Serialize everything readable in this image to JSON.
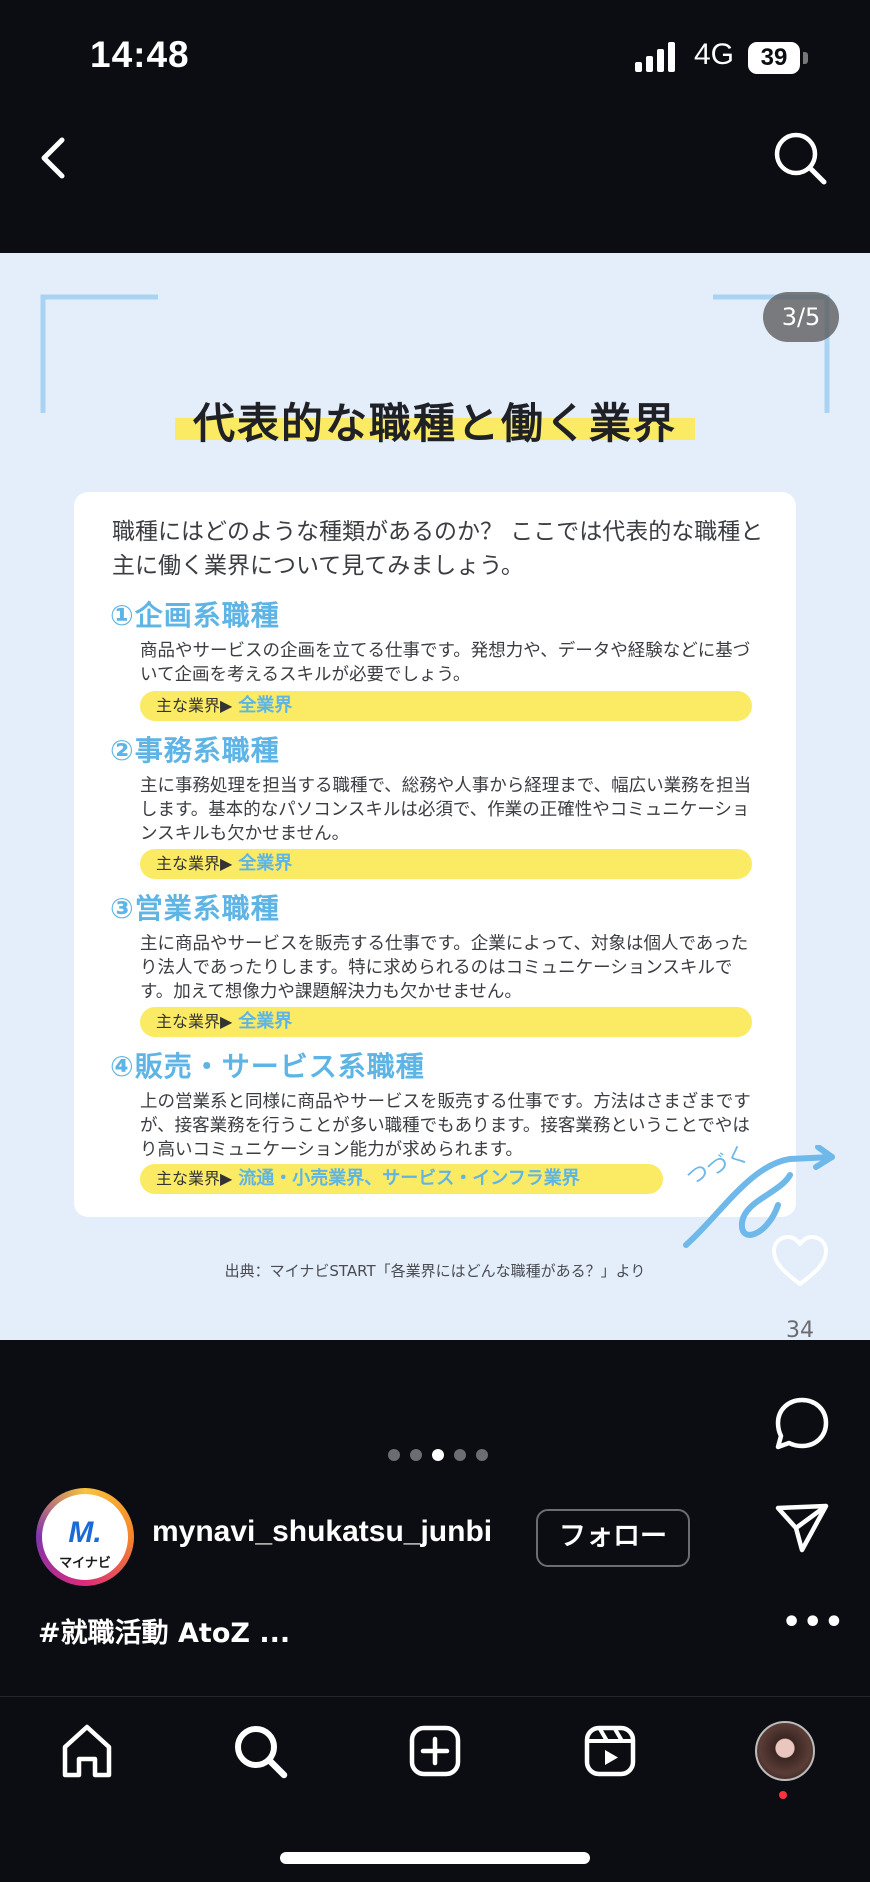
{
  "status_bar": {
    "time": "14:48",
    "network": "4G",
    "battery": "39"
  },
  "post": {
    "counter": "3/5",
    "title": "代表的な職種と働く業界",
    "intro": "職種にはどのような種類があるのか？ ここでは代表的な職種と主に働く業界について見てみましょう。",
    "industry_prefix": "主な業界▶",
    "sections": [
      {
        "heading": "①企画系職種",
        "body": "商品やサービスの企画を立てる仕事です。発想力や、データや経験などに基づいて企画を考えるスキルが必要でしょう。",
        "industry": "全業界"
      },
      {
        "heading": "②事務系職種",
        "body": "主に事務処理を担当する職種で、総務や人事から経理まで、幅広い業務を担当します。基本的なパソコンスキルは必須で、作業の正確性やコミュニケーションスキルも欠かせません。",
        "industry": "全業界"
      },
      {
        "heading": "③営業系職種",
        "body": "主に商品やサービスを販売する仕事です。企業によって、対象は個人であったり法人であったりします。特に求められるのはコミュニケーションスキルです。加えて想像力や課題解決力も欠かせません。",
        "industry": "全業界"
      },
      {
        "heading": "④販売・サービス系職種",
        "body": "上の営業系と同様に商品やサービスを販売する仕事です。方法はさまざまですが、接客業務を行うことが多い職種でもあります。接客業務ということでやはり高いコミュニケーション能力が求められます。",
        "industry": "流通・小売業界、サービス・インフラ業界"
      }
    ],
    "continue_text": "つづく",
    "source": "出典：マイナビSTART「各業界にはどんな職種がある？」より"
  },
  "actions": {
    "like_count": "34"
  },
  "carousel": {
    "total": 5,
    "active": 2
  },
  "account": {
    "logo_text": "M.",
    "logo_sub": "マイナビ",
    "username": "mynavi_shukatsu_junbi",
    "follow_label": "フォロー"
  },
  "caption": "#就職活動 AtoZ ...",
  "more_label": "•••",
  "colors": {
    "accent_blue": "#5eb5e5",
    "highlight_yellow": "#fbeb64",
    "post_bg": "#e4eefa",
    "app_bg": "#0c0d12"
  },
  "nav_icons": [
    "home-icon",
    "search-icon",
    "create-icon",
    "reels-icon",
    "profile-avatar"
  ]
}
